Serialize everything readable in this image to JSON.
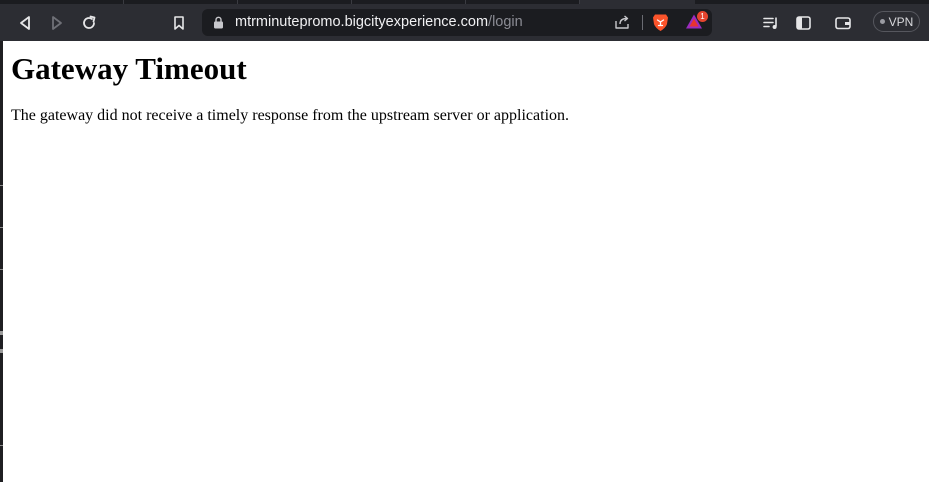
{
  "browser": {
    "url_host": "mtrminutepromo.bigcityexperience.com",
    "url_path": "/login",
    "rewards_badge_count": "1",
    "vpn_label": "VPN",
    "icons": {
      "back": "back-arrow-icon",
      "forward": "forward-arrow-icon",
      "reload": "reload-icon",
      "bookmark": "bookmark-icon",
      "lock": "lock-icon",
      "share": "share-icon",
      "brave_shields": "brave-lion-icon",
      "rewards": "brave-rewards-triangle-icon",
      "playlist": "playlist-icon",
      "sidebar": "sidebar-icon",
      "wallet": "wallet-icon"
    },
    "colors": {
      "toolbar": "#2c2d33",
      "urlbar": "#1b1c20",
      "brave_orange": "#fb542b"
    }
  },
  "page": {
    "heading": "Gateway Timeout",
    "message": "The gateway did not receive a timely response from the upstream server or application."
  }
}
